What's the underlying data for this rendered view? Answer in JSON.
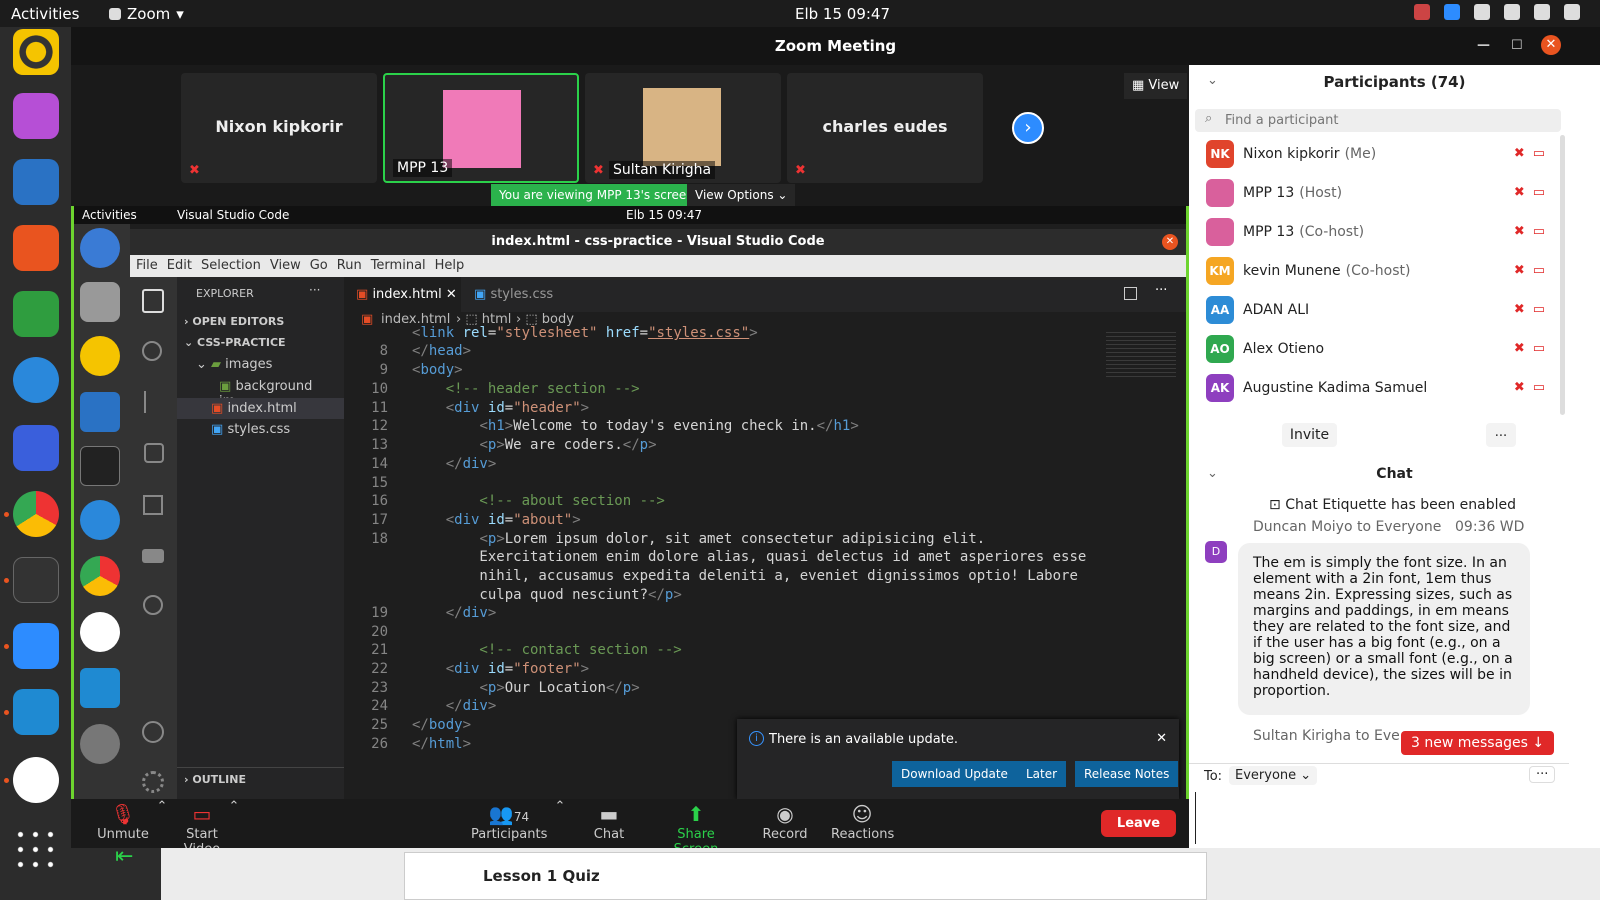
{
  "topbar": {
    "activities": "Activities",
    "app": "Zoom",
    "clock": "Elb 15  09:47"
  },
  "zoom": {
    "title": "Zoom Meeting",
    "view_label": "View",
    "tiles": [
      {
        "name": "Nixon kipkorir"
      },
      {
        "label": "MPP 13"
      },
      {
        "label": "Sultan Kirigha"
      },
      {
        "name": "charles eudes"
      }
    ],
    "viewing_banner": "You are viewing MPP 13's screen",
    "view_options": "View Options"
  },
  "shared": {
    "activities": "Activities",
    "app": "Visual Studio Code",
    "clock": "Elb 15  09:47",
    "title": "index.html - css-practice - Visual Studio Code",
    "menu": [
      "File",
      "Edit",
      "Selection",
      "View",
      "Go",
      "Run",
      "Terminal",
      "Help"
    ],
    "explorer": {
      "header": "EXPLORER",
      "open_editors": "OPEN EDITORS",
      "project": "CSS-PRACTICE",
      "folder": "images",
      "file_bg": "background im...",
      "file_index": "index.html",
      "file_styles": "styles.css",
      "outline": "OUTLINE"
    },
    "tabs": [
      "index.html",
      "styles.css"
    ],
    "crumbs": [
      "index.html",
      "html",
      "body"
    ],
    "line_numbers": [
      "8",
      "9",
      "10",
      "11",
      "12",
      "13",
      "14",
      "15",
      "16",
      "17",
      "18",
      "",
      "",
      "",
      "19",
      "20",
      "21",
      "22",
      "23",
      "24",
      "25",
      "26"
    ],
    "update": {
      "message": "There is an available update.",
      "download": "Download Update",
      "later": "Later",
      "notes": "Release Notes"
    }
  },
  "toolbar": {
    "unmute": "Unmute",
    "start_video": "Start Video",
    "participants_count": "74",
    "participants": "Participants",
    "chat": "Chat",
    "share": "Share Screen",
    "record": "Record",
    "reactions": "Reactions",
    "leave": "Leave"
  },
  "panel": {
    "participants_title": "Participants (74)",
    "search_placeholder": "Find a participant",
    "participants": [
      {
        "initials": "NK",
        "name": "Nixon kipkorir",
        "role": "(Me)",
        "color": "#e0442c"
      },
      {
        "initials": "",
        "name": "MPP 13",
        "role": "(Host)",
        "color": "#d9609c"
      },
      {
        "initials": "",
        "name": "MPP 13",
        "role": "(Co-host)",
        "color": "#d9609c"
      },
      {
        "initials": "KM",
        "name": "kevin Munene",
        "role": "(Co-host)",
        "color": "#f5a623"
      },
      {
        "initials": "AA",
        "name": "ADAN ALI",
        "role": "",
        "color": "#2d8cd6"
      },
      {
        "initials": "AO",
        "name": "Alex Otieno",
        "role": "",
        "color": "#2fa84f"
      },
      {
        "initials": "AK",
        "name": "Augustine Kadima Samuel",
        "role": "",
        "color": "#8e3fbf"
      }
    ],
    "invite": "Invite",
    "more": "...",
    "chat_title": "Chat",
    "etiquette": "Chat Etiquette has been enabled",
    "msg_from": "Duncan Moiyo to Everyone",
    "msg_time": "09:36 WD",
    "msg_avatar": "D",
    "msg_text": "The em is simply the font size. In an element with a 2in font, 1em thus means 2in. Expressing sizes, such as margins and paddings, in em means they are related to the font size, and if the user has a big font (e.g., on a big screen) or a small font (e.g., on a handheld device), the sizes will be in proportion.",
    "msg2_from": "Sultan Kirigha to Eve",
    "new_messages": "3 new messages ↓",
    "to_label": "To:",
    "to_value": "Everyone"
  },
  "bottom": {
    "quiz": "Lesson 1 Quiz"
  }
}
